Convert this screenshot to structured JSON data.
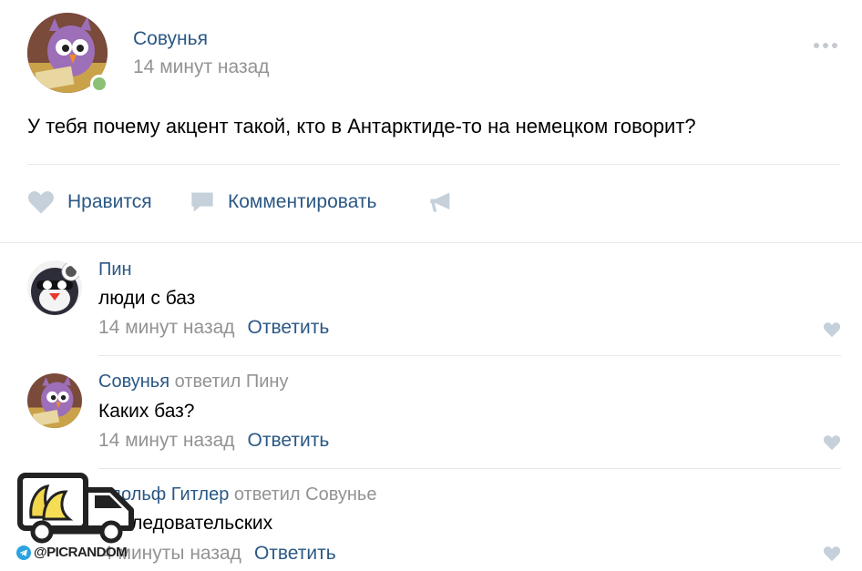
{
  "post": {
    "author": "Совунья",
    "time": "14 минут назад",
    "text": "У тебя почему акцент такой, кто в Антарктиде-то на немецком говорит?",
    "avatar_icon": "owl-avatar"
  },
  "actions": {
    "like_label": "Нравится",
    "comment_label": "Комментировать",
    "share_icon": "megaphone-icon"
  },
  "comments": [
    {
      "author": "Пин",
      "replied_to": "",
      "text": "люди с баз",
      "time": "14 минут назад",
      "reply_label": "Ответить"
    },
    {
      "author": "Совунья",
      "replied_to": "ответил Пину",
      "text": "Каких баз?",
      "time": "14 минут назад",
      "reply_label": "Ответить"
    },
    {
      "author": "Адольф Гитлер",
      "replied_to": "ответил Совунье",
      "text": "Исследовательских",
      "time": "4 минуты назад",
      "reply_label": "Ответить"
    }
  ],
  "watermark": {
    "handle": "@PICRANDOM"
  },
  "colors": {
    "link": "#2a5885",
    "muted": "#939393",
    "icon": "#c5d0db",
    "separator": "#e7e8ec",
    "online": "#8ac176"
  }
}
